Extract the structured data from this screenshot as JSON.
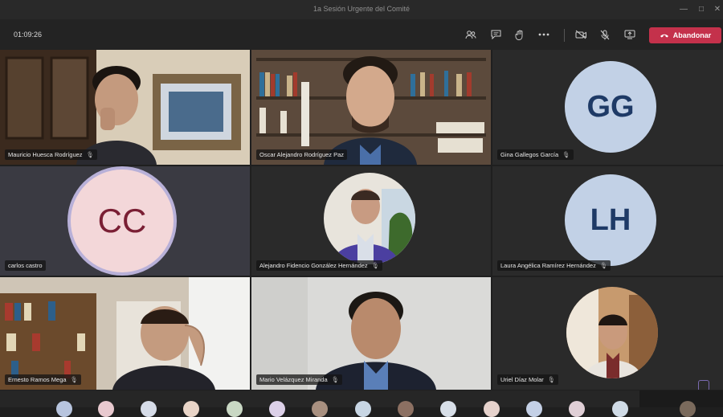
{
  "window": {
    "title": "1a Sesión Urgente del Comité"
  },
  "toolbar": {
    "timer": "01:09:26",
    "leave_label": "Abandonar",
    "leave_color": "#c4314b"
  },
  "participants": [
    {
      "name": "Mauricio Huesca Rodríguez",
      "mic": "muted-mic-icon"
    },
    {
      "name": "Oscar Alejandro Rodríguez Paz",
      "mic": "none"
    },
    {
      "name": "Gina Gallegos García",
      "initials": "GG",
      "mic": "muted-mic-icon"
    },
    {
      "name": "carlos castro",
      "initials": "CC",
      "mic": "none"
    },
    {
      "name": "Alejandro Fidencio González Hernández",
      "mic": "muted-mic-icon"
    },
    {
      "name": "Laura Angélica Ramírez Hernández",
      "initials": "LH",
      "mic": "muted-mic-icon"
    },
    {
      "name": "Ernesto Ramos Mega",
      "mic": "muted-mic-icon"
    },
    {
      "name": "Mario Velázquez Miranda",
      "mic": "muted-mic-icon"
    },
    {
      "name": "Uriel Díaz Molar",
      "mic": "muted-mic-icon"
    }
  ],
  "icons": [
    "participants-icon",
    "chat-icon",
    "raise-hand-icon",
    "more-icon",
    "camera-off-icon",
    "mic-off-icon",
    "share-screen-icon",
    "phone-hangup-icon"
  ]
}
